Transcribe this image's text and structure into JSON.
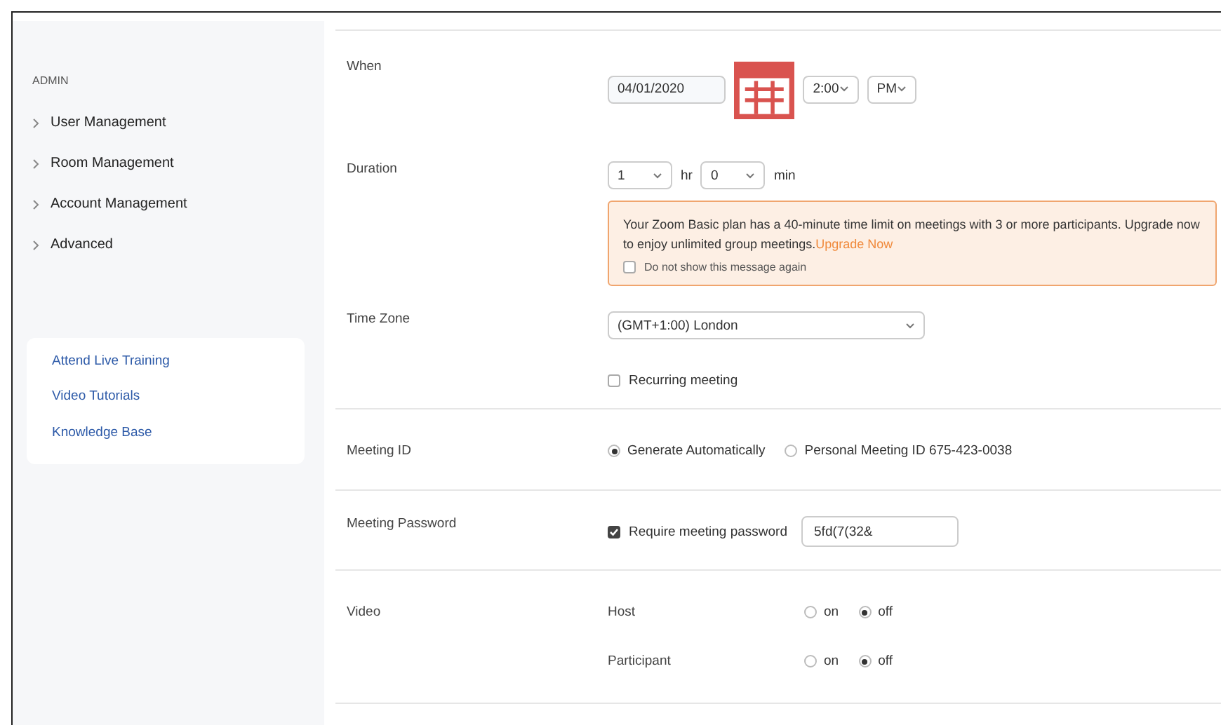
{
  "sidebar": {
    "section_title": "ADMIN",
    "items": [
      {
        "label": "User Management",
        "expanded": false
      },
      {
        "label": "Room Management",
        "expanded": false
      },
      {
        "label": "Account Management",
        "expanded": false
      },
      {
        "label": "Advanced",
        "expanded": false
      }
    ],
    "help_links": [
      "Attend Live Training",
      "Video Tutorials",
      "Knowledge Base"
    ]
  },
  "form": {
    "when": {
      "label": "When",
      "date": "04/01/2020",
      "time": "2:00",
      "period": "PM"
    },
    "duration": {
      "label": "Duration",
      "hours": "1",
      "hours_unit": "hr",
      "minutes": "0",
      "minutes_unit": "min"
    },
    "notice": {
      "text": "Your Zoom Basic plan has a 40-minute time limit on meetings with 3 or more participants. Upgrade now to enjoy unlimited group meetings.",
      "link": "Upgrade Now",
      "checkbox": {
        "label": "Do not show this message again",
        "checked": false
      }
    },
    "time_zone": {
      "label": "Time Zone",
      "value": "(GMT+1:00) London"
    },
    "recurring": {
      "label": "Recurring meeting",
      "checked": false
    },
    "meeting_id": {
      "label": "Meeting ID",
      "options": [
        {
          "label": "Generate Automatically",
          "selected": true
        },
        {
          "label": "Personal Meeting ID 675-423-0038",
          "selected": false
        }
      ]
    },
    "password": {
      "label": "Meeting Password",
      "checkbox_label": "Require meeting password",
      "checked": true,
      "value": "5fd(7(32&"
    },
    "video": {
      "label": "Video",
      "rows": [
        {
          "label": "Host",
          "options": [
            {
              "label": "on",
              "selected": false
            },
            {
              "label": "off",
              "selected": true
            }
          ]
        },
        {
          "label": "Participant",
          "options": [
            {
              "label": "on",
              "selected": false
            },
            {
              "label": "off",
              "selected": true
            }
          ]
        }
      ]
    }
  }
}
